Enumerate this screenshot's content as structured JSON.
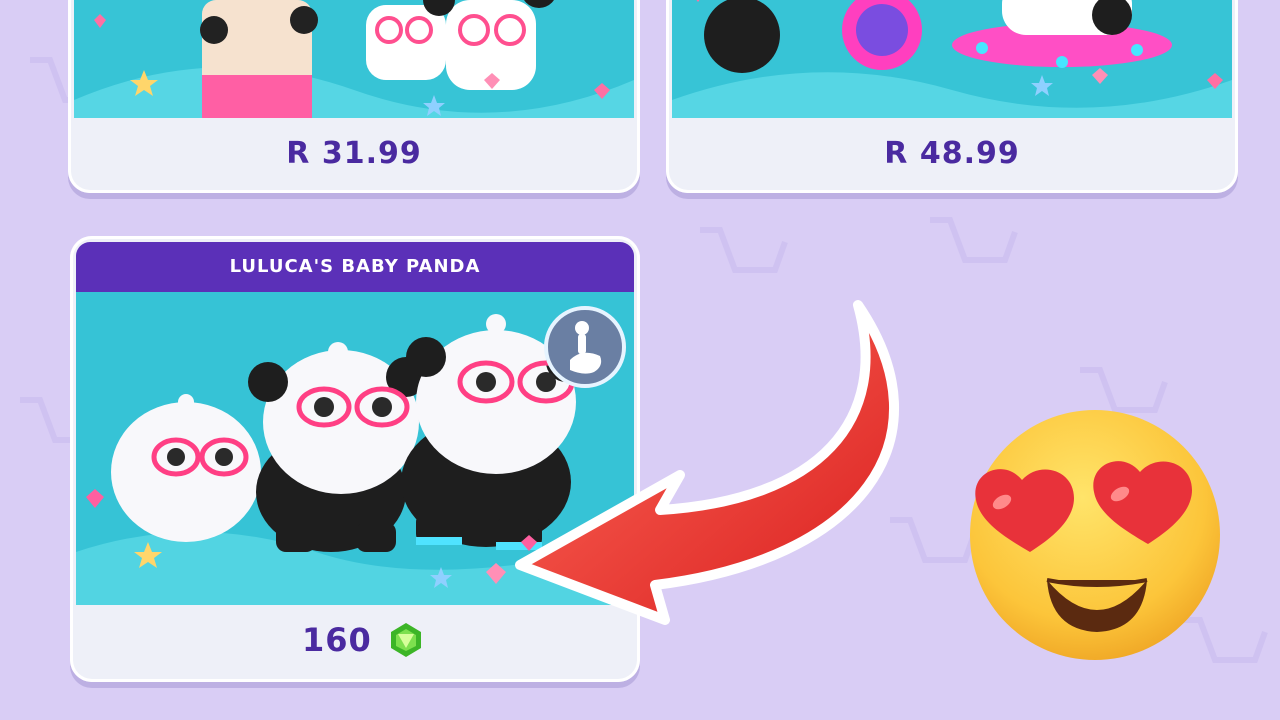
{
  "shop": {
    "cards": [
      {
        "price": "R 31.99"
      },
      {
        "price": "R 48.99"
      },
      {
        "title": "LULUCA'S BABY PANDA",
        "price": "160",
        "currency_icon": "gem-icon"
      }
    ]
  },
  "colors": {
    "background": "#d9cdf5",
    "header": "#5b30b8",
    "price_text": "#4a2aa0",
    "art_bg": "#3fd0e0",
    "arrow": "#e83030"
  },
  "overlay": {
    "arrow_icon": "curved-arrow-icon",
    "emoji_icon": "heart-eyes-emoji-icon"
  }
}
